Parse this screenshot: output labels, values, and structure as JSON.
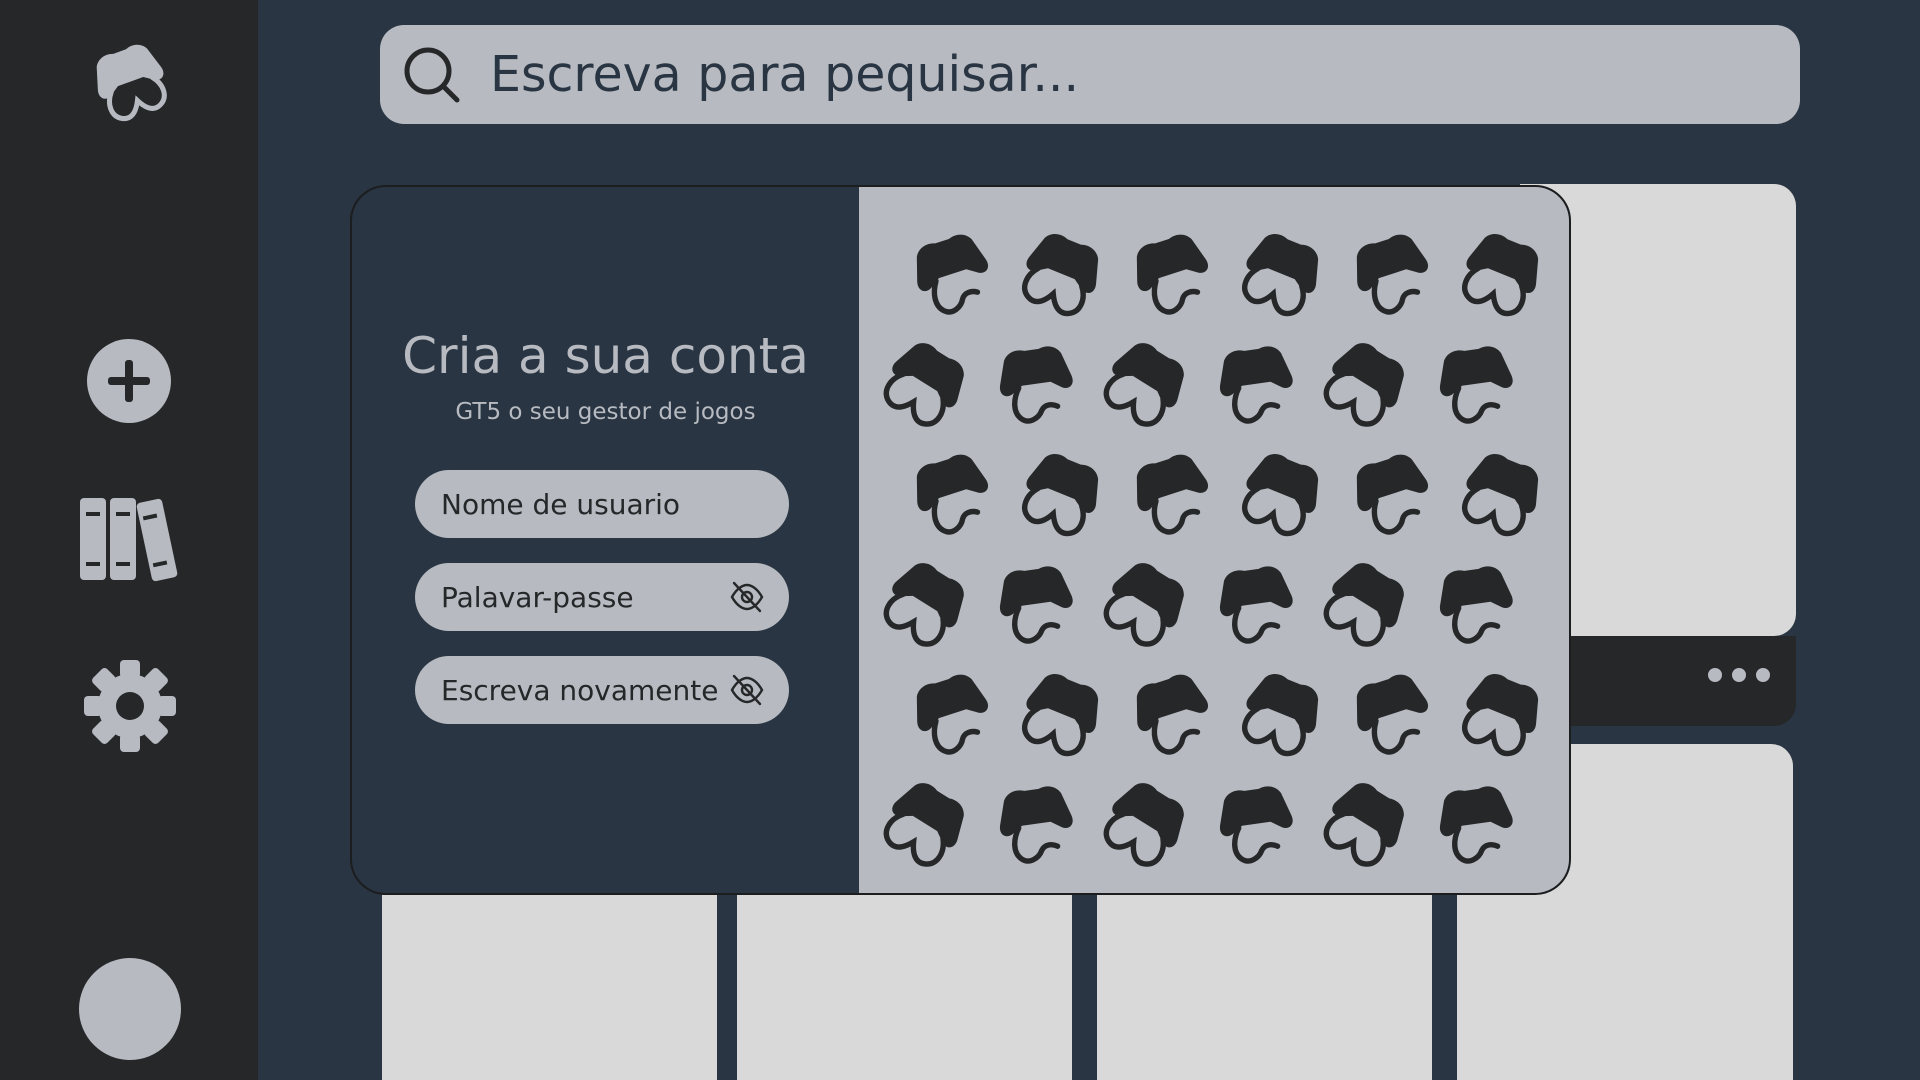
{
  "sidebar": {
    "logo_icon": "gamepad-logo-icon",
    "items": [
      {
        "icon": "plus-circle-icon",
        "name": "add"
      },
      {
        "icon": "library-books-icon",
        "name": "library"
      },
      {
        "icon": "gear-icon",
        "name": "settings"
      }
    ],
    "avatar": "user-avatar"
  },
  "search": {
    "icon": "search-icon",
    "placeholder": "Escreva para pequisar..."
  },
  "modal": {
    "title": "Cria a sua conta",
    "subtitle": "GT5 o seu gestor de jogos",
    "fields": {
      "username_placeholder": "Nome de usuario",
      "password_placeholder": "Palavar-passe",
      "confirm_placeholder": "Escreva novamente"
    },
    "eye_icon": "eye-off-icon",
    "art_icon": "gamepad-pattern-icon"
  },
  "background": {
    "card_menu_icon": "more-dots-icon"
  },
  "colors": {
    "background": "#293542",
    "sidebar": "#252729",
    "surface": "#b7bbc1",
    "card": "#d9d9d9",
    "icon_dark": "#252729"
  }
}
